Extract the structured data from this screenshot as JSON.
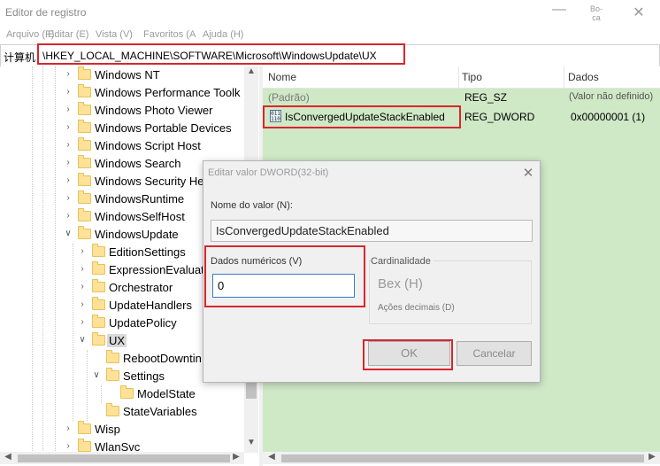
{
  "window": {
    "title": "Editor de registro",
    "controls": {
      "minimize": "—",
      "maximize": "Bo-\nca",
      "close": "✕"
    }
  },
  "menu": [
    "Arquivo (F)",
    "Editar (E)",
    "Vista (V)",
    "Favoritos (A",
    "Ajuda (H)"
  ],
  "address": {
    "prefix": "计算机",
    "path": "\\HKEY_LOCAL_MACHINE\\SOFTWARE\\Microsoft\\WindowsUpdate\\UX"
  },
  "tree": {
    "items": [
      {
        "label": "Windows NT",
        "expander": "collapsed",
        "level": 0
      },
      {
        "label": "Windows Performance Toolk",
        "expander": "collapsed",
        "level": 0
      },
      {
        "label": "Windows Photo Viewer",
        "expander": "collapsed",
        "level": 0
      },
      {
        "label": "Windows Portable Devices",
        "expander": "collapsed",
        "level": 0
      },
      {
        "label": "Windows Script Host",
        "expander": "collapsed",
        "level": 0
      },
      {
        "label": "Windows Search",
        "expander": "collapsed",
        "level": 0
      },
      {
        "label": "Windows Security He",
        "expander": "collapsed",
        "level": 0
      },
      {
        "label": "WindowsRuntime",
        "expander": "collapsed",
        "level": 0
      },
      {
        "label": "WindowsSelfHost",
        "expander": "collapsed",
        "level": 0
      },
      {
        "label": "WindowsUpdate",
        "expander": "expanded",
        "level": 0
      },
      {
        "label": "EditionSettings",
        "expander": "collapsed",
        "level": 1
      },
      {
        "label": "ExpressionEvaluato",
        "expander": "collapsed",
        "level": 1
      },
      {
        "label": "Orchestrator",
        "expander": "collapsed",
        "level": 1
      },
      {
        "label": "UpdateHandlers",
        "expander": "collapsed",
        "level": 1
      },
      {
        "label": "UpdatePolicy",
        "expander": "collapsed",
        "level": 1
      },
      {
        "label": "UX",
        "expander": "expanded",
        "level": 1,
        "selected": true
      },
      {
        "label": "RebootDowntin",
        "expander": "none",
        "level": 2
      },
      {
        "label": "Settings",
        "expander": "expanded",
        "level": 2
      },
      {
        "label": "ModelState",
        "expander": "none",
        "level": 3
      },
      {
        "label": "StateVariables",
        "expander": "none",
        "level": 2
      },
      {
        "label": "Wisp",
        "expander": "collapsed",
        "level": 0
      },
      {
        "label": "WlanSvc",
        "expander": "collapsed",
        "level": 0
      }
    ]
  },
  "list": {
    "columns": [
      "Nome",
      "Tipo",
      "Dados"
    ],
    "rows": [
      {
        "name": "(Padrão)",
        "type": "REG_SZ",
        "data": "(Valor não definido)"
      },
      {
        "name": "IsConvergedUpdateStackEnabled",
        "type": "REG_DWORD",
        "data": "0x00000001 (1)",
        "icon_text": "011\n110"
      }
    ]
  },
  "dialog": {
    "title": "Editar valor DWORD(32-bit)",
    "close": "✕",
    "value_name_label": "Nome do valor (N):",
    "value_name": "IsConvergedUpdateStackEnabled",
    "value_data_label": "Dados numéricos (V)",
    "value_data": "0",
    "base_label": "Cardinalidade",
    "hex_label": "Bex (H)",
    "decimal_label": "Ações decimais (D)",
    "ok_label": "OK",
    "cancel_label": "Cancelar"
  },
  "colors": {
    "highlight": "#d9262c",
    "list_background": "#cfe8c6",
    "input_border": "#3a78c8"
  },
  "icons": {
    "tree_up": "▲",
    "tree_down": "▼",
    "tree_left": "◀",
    "tree_right": "▶",
    "list_left": "◀",
    "list_right": "▶"
  }
}
